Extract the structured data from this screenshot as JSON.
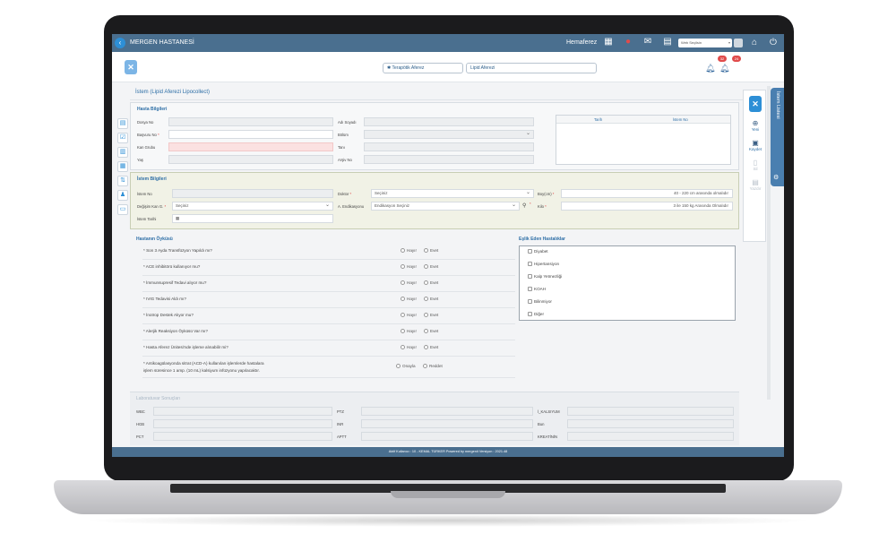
{
  "app": {
    "title": "MERGEN HASTANESİ",
    "user": "Hemaferez",
    "web_select": "Web Seçilsin",
    "tabs": [
      "Terapötik Aferez",
      "Lipid Aferezi"
    ],
    "notifications": [
      "32",
      "24"
    ]
  },
  "page": {
    "title": "İstem (Lipid Aferezi Lipocollect)"
  },
  "patient": {
    "title": "Hasta Bilgileri",
    "labels": {
      "dosya_no": "Dosya No",
      "basvuru_no": "Başvuru No",
      "kan_grubu": "Kan Grubu",
      "yas": "Yaş",
      "ad_soyad": "Adı Soyadı",
      "bolum": "Bölüm",
      "tanı": "Tanı",
      "arsiv_no": "Arşiv No"
    },
    "table_headers": [
      "Tarih",
      "İstem No"
    ]
  },
  "request": {
    "title": "İstem Bilgileri",
    "labels": {
      "istem_no": "İstem No",
      "degisim": "Değişim Kan G.",
      "istem_tarihi": "İstem Tarihi",
      "doktor": "Doktor",
      "endikasyonu": "A. Endikasyonu",
      "boy": "Boy(cm)",
      "kilo": "Kilo"
    },
    "degisim_value": "Seçiniz",
    "doktor_value": "Seçiniz",
    "endikasyon_value": "Endikasyon Seçiniz",
    "boy_hint": "40 - 220 cm arasında olmalıdır",
    "kilo_hint": "3 ile 150 kg Arasında Olmalıdır"
  },
  "history": {
    "title": "Hastanın Öyküsü",
    "questions": [
      "* Son 3 Ayda Transfüzyon Yapıldı mı?",
      "* ACE inhibitörü kullanıyor mu?",
      "* İmmunsupresif Tedavi alıyor mu?",
      "* IVIG Tedavisi Aldı mı?",
      "* İnotrop Destek Alıyor mu?",
      "* Alerjik Reaksiyon Öyküsü Var mı?",
      "* Hasta Aferez Ünitesi'nde işleme alınabilir mi?"
    ],
    "no": "Hayır",
    "yes": "Evet",
    "consent_line1": "* Antikoagülasyonda sitrat (ACD-A) kullanılan işlemlerde hastalara",
    "consent_line2": "işlem süresince 1 amp. (10 mL) kalsiyum infüzyonu yapılacaktır.",
    "approve": "Onayla",
    "reject": "Reddet"
  },
  "diseases": {
    "title": "Eşlik Eden Hastalıklar",
    "items": [
      "Diyabet",
      "Hipertansiyon",
      "Kalp Yetmezliği",
      "KOAH",
      "Bilinmiyor",
      "Diğer"
    ]
  },
  "lab": {
    "title": "Laboratuvar Sonuçları",
    "labels": [
      "WBC",
      "HGB",
      "PCT",
      "PTZ",
      "INR",
      "APTT",
      "İ_KALSIYUM",
      "Bun",
      "KREATİNİN"
    ]
  },
  "actions": {
    "new": "Yeni",
    "save": "Kaydet",
    "delete": "Sil",
    "print": "Yazdır"
  },
  "side_tab": "İstem Listesi",
  "footer": "Aktif Kullanıcı : 10 - KEMAL TÜRKER    Powered by  mergenit    Versiyon : 2021.48"
}
